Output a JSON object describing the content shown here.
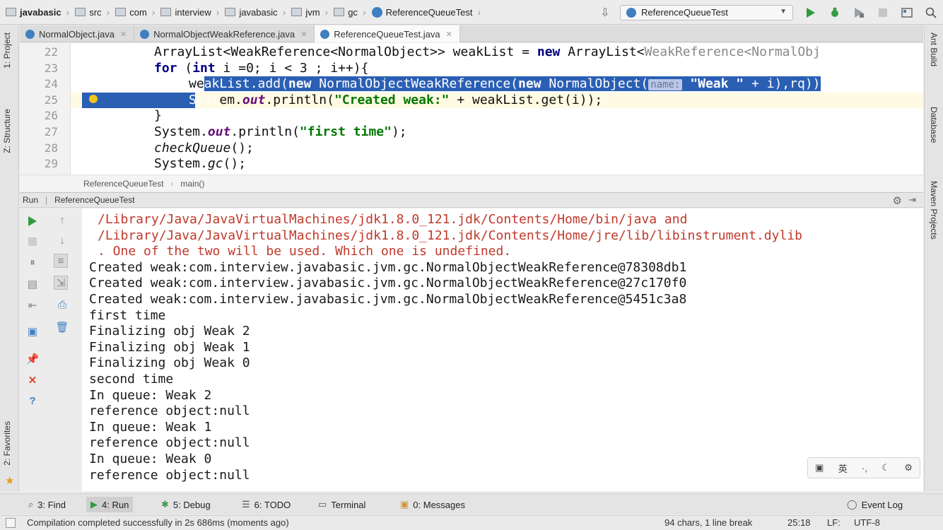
{
  "navbar": {
    "breadcrumbs": [
      "javabasic",
      "src",
      "com",
      "interview",
      "javabasic",
      "jvm",
      "gc",
      "ReferenceQueueTest"
    ],
    "run_config": "ReferenceQueueTest"
  },
  "left_strip": {
    "project": "1: Project",
    "structure": "Z: Structure",
    "favorites": "2: Favorites"
  },
  "right_strip": {
    "ant": "Ant Build",
    "database": "Database",
    "maven": "Maven Projects"
  },
  "editor_tabs": [
    {
      "label": "NormalObject.java"
    },
    {
      "label": "NormalObjectWeakReference.java"
    },
    {
      "label": "ReferenceQueueTest.java"
    }
  ],
  "editor": {
    "line_numbers": [
      "22",
      "23",
      "24",
      "25",
      "26",
      "27",
      "28",
      "29"
    ],
    "l22": {
      "a": "ArrayList<WeakReference<NormalObject>> weakList = ",
      "kw": "new",
      "b": " ArrayList<",
      "gen": "WeakReference<NormalObj"
    },
    "l23": {
      "kw1": "for",
      "a": " (",
      "kw2": "int",
      "b": " i =0; i < 3 ; i++){"
    },
    "l24": {
      "a": "we",
      "s1": "akList.add(",
      "kw1": "new",
      "s2": " NormalObjectWeakReference(",
      "kw2": "new",
      "s3": " NormalObject(",
      "hint": "name:",
      "s4": " ",
      "str": "\"Weak \"",
      "s5": " + i),rq))"
    },
    "l25": {
      "a": "Syst",
      "b": "em.",
      "fld": "out",
      "c": ".println(",
      "str": "\"Created weak:\"",
      "d": " + weakList.get(i));"
    },
    "l26": "}",
    "l27": {
      "a": "System.",
      "fld": "out",
      "b": ".println(",
      "str": "\"first time\"",
      "c": ");"
    },
    "l28": {
      "it": "checkQueue",
      "a": "();"
    },
    "l29": {
      "a": "System.",
      "it": "gc",
      "b": "();"
    }
  },
  "editor_breadcrumb": {
    "class": "ReferenceQueueTest",
    "method": "main()"
  },
  "run_panel": {
    "title": "Run",
    "config": "ReferenceQueueTest",
    "console": [
      {
        "text": "/Library/Java/JavaVirtualMachines/jdk1.8.0_121.jdk/Contents/Home/bin/java and",
        "kind": "err"
      },
      {
        "text": "/Library/Java/JavaVirtualMachines/jdk1.8.0_121.jdk/Contents/Home/jre/lib/libinstrument.dylib",
        "kind": "err"
      },
      {
        "text": ". One of the two will be used. Which one is undefined.",
        "kind": "err"
      },
      {
        "text": "Created weak:com.interview.javabasic.jvm.gc.NormalObjectWeakReference@78308db1",
        "kind": "out"
      },
      {
        "text": "Created weak:com.interview.javabasic.jvm.gc.NormalObjectWeakReference@27c170f0",
        "kind": "out"
      },
      {
        "text": "Created weak:com.interview.javabasic.jvm.gc.NormalObjectWeakReference@5451c3a8",
        "kind": "out"
      },
      {
        "text": "first time",
        "kind": "out"
      },
      {
        "text": "Finalizing obj Weak 2",
        "kind": "out"
      },
      {
        "text": "Finalizing obj Weak 1",
        "kind": "out"
      },
      {
        "text": "Finalizing obj Weak 0",
        "kind": "out"
      },
      {
        "text": "second time",
        "kind": "out"
      },
      {
        "text": "In queue: Weak 2",
        "kind": "out"
      },
      {
        "text": "reference object:null",
        "kind": "out"
      },
      {
        "text": "In queue: Weak 1",
        "kind": "out"
      },
      {
        "text": "reference object:null",
        "kind": "out"
      },
      {
        "text": "In queue: Weak 0",
        "kind": "out"
      },
      {
        "text": "reference object:null",
        "kind": "out"
      }
    ]
  },
  "bottom_tools": {
    "find": "3: Find",
    "run": "4: Run",
    "debug": "5: Debug",
    "todo": "6: TODO",
    "terminal": "Terminal",
    "messages": "0: Messages",
    "event_log": "Event Log"
  },
  "status": {
    "message": "Compilation completed successfully in 2s 686ms (moments ago)",
    "chars": "94 chars, 1 line break",
    "position": "25:18",
    "line_sep": "LF:",
    "encoding": "UTF-8"
  },
  "colors": {
    "selection": "#2a5fb4",
    "keyword": "#000080",
    "string": "#007800",
    "error_text": "#c0392b",
    "run_green": "#2e9c3e"
  }
}
